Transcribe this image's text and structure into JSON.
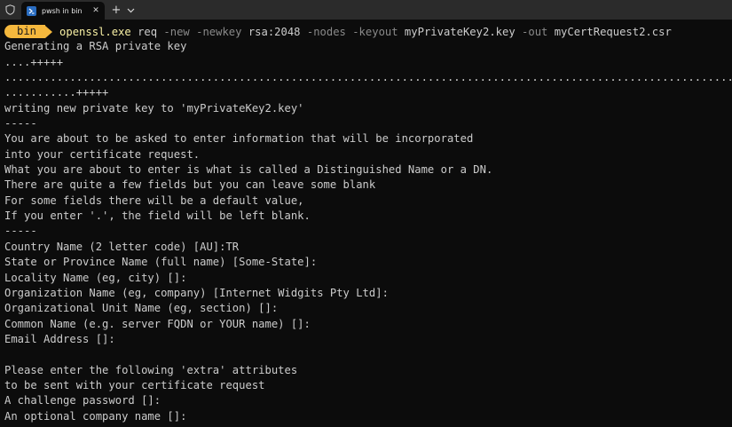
{
  "tab": {
    "title": "pwsh in bin",
    "close_glyph": "✕",
    "new_tab_glyph": "+",
    "dropdown_glyph": "⌄",
    "shield_icon": "shield-icon",
    "terminal_icon": "powershell-icon"
  },
  "prompt": {
    "location": "bin",
    "command": "openssl.exe",
    "args": [
      {
        "text": " req ",
        "style": "arg"
      },
      {
        "text": "-new -newkey",
        "style": "flag"
      },
      {
        "text": " rsa:2048 ",
        "style": "arg"
      },
      {
        "text": "-nodes -keyout",
        "style": "flag"
      },
      {
        "text": " myPrivateKey2.key ",
        "style": "arg"
      },
      {
        "text": "-out",
        "style": "flag"
      },
      {
        "text": " myCertRequest2.csr",
        "style": "arg"
      }
    ]
  },
  "output_lines": [
    "Generating a RSA private key",
    "....+++++",
    "......................................................................................................................................................",
    "...........+++++",
    "writing new private key to 'myPrivateKey2.key'",
    "-----",
    "You are about to be asked to enter information that will be incorporated",
    "into your certificate request.",
    "What you are about to enter is what is called a Distinguished Name or a DN.",
    "There are quite a few fields but you can leave some blank",
    "For some fields there will be a default value,",
    "If you enter '.', the field will be left blank.",
    "-----",
    "Country Name (2 letter code) [AU]:TR",
    "State or Province Name (full name) [Some-State]:",
    "Locality Name (eg, city) []:",
    "Organization Name (eg, company) [Internet Widgits Pty Ltd]:",
    "Organizational Unit Name (eg, section) []:",
    "Common Name (e.g. server FQDN or YOUR name) []:",
    "Email Address []:",
    "",
    "Please enter the following 'extra' attributes",
    "to be sent with your certificate request",
    "A challenge password []:",
    "An optional company name []:"
  ],
  "colors": {
    "background": "#0c0c0c",
    "tabbar": "#2b2b2b",
    "badge": "#f5b83d",
    "command": "#f9f1a5",
    "flag": "#8a8a8a",
    "text": "#cccccc"
  }
}
